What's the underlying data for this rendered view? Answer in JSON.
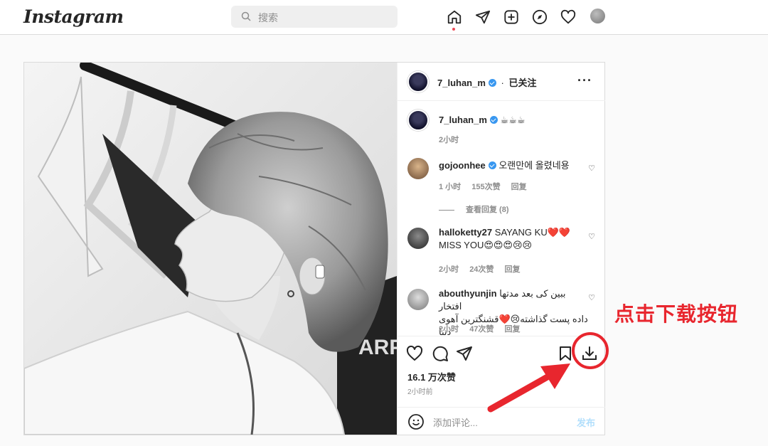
{
  "app": {
    "logo": "Instagram"
  },
  "search": {
    "placeholder": "搜索"
  },
  "nav": {
    "icons": [
      "home-icon",
      "direct-icon",
      "new-post-icon",
      "explore-icon",
      "activity-icon",
      "profile-avatar"
    ]
  },
  "post": {
    "author": "7_luhan_m",
    "follow_status": "已关注",
    "caption_emoji": "☕☕☕",
    "caption_time": "2小时",
    "comments": [
      {
        "user": "gojoonhee",
        "verified": true,
        "text": "오랜만에 올렸네용",
        "time": "1 小时",
        "likes": "155次赞",
        "reply": "回复",
        "view_replies": "查看回复 (8)"
      },
      {
        "user": "halloketty27",
        "verified": false,
        "text": "SAYANG KU❤️❤️",
        "text2": "MISS YOU😍😍😍😢😢",
        "time": "2小时",
        "likes": "24次赞",
        "reply": "回复"
      },
      {
        "user": "abouthyunjin",
        "verified": false,
        "text": "ببین کی بعد مدتها افتخار",
        "text2": "داده پست گذاشته😢❤️قشنگترین آهوی دنیا",
        "time": "2小时",
        "likes": "47次赞",
        "reply": "回复"
      }
    ],
    "likes_count": "16.1 万次赞",
    "posted_time": "2小时前",
    "add_comment_placeholder": "添加评论...",
    "post_button": "发布"
  },
  "annotation": {
    "text": "点击下载按钮",
    "color": "#e8262e"
  }
}
